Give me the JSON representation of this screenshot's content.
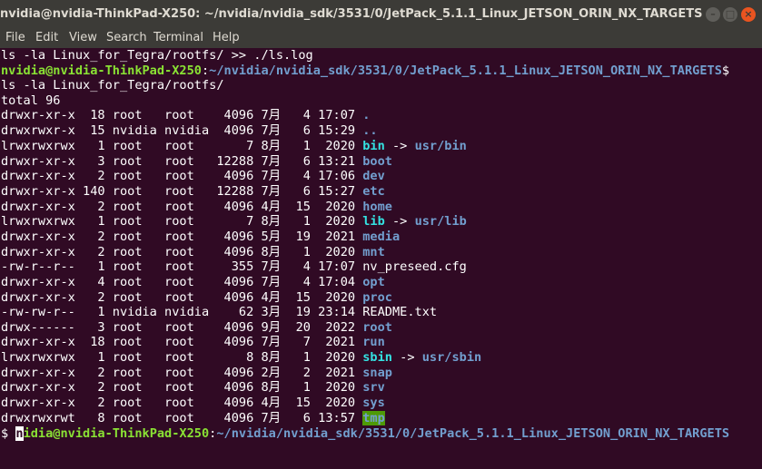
{
  "window": {
    "title": "nvidia@nvidia-ThinkPad-X250: ~/nvidia/nvidia_sdk/3531/0/JetPack_5.1.1_Linux_JETSON_ORIN_NX_TARGETS",
    "minimize_label": "–",
    "maximize_label": "□",
    "close_label": "×"
  },
  "menu": [
    "File",
    "Edit",
    "View",
    "Search",
    "Terminal",
    "Help"
  ],
  "terminal": {
    "cmd1": "ls -la Linux_for_Tegra/rootfs/ >> ./ls.log",
    "prompt_user": "nvidia@nvidia-ThinkPad-X250",
    "prompt_sep": ":",
    "prompt_path": "~/nvidia/nvidia_sdk/3531/0/JetPack_5.1.1_Linux_JETSON_ORIN_NX_TARGETS",
    "prompt_end": "$",
    "cmd2": "ls -la Linux_for_Tegra/rootfs/",
    "total": "total 96",
    "entries": [
      {
        "meta": "drwxr-xr-x  18 root   root    4096 7月   4 17:07 ",
        "name": ".",
        "kind": "dir"
      },
      {
        "meta": "drwxrwxr-x  15 nvidia nvidia  4096 7月   6 15:29 ",
        "name": "..",
        "kind": "dir"
      },
      {
        "meta": "lrwxrwxrwx   1 root   root       7 8月   1  2020 ",
        "name": "bin",
        "kind": "link",
        "target": "usr/bin"
      },
      {
        "meta": "drwxr-xr-x   3 root   root   12288 7月   6 13:21 ",
        "name": "boot",
        "kind": "dir"
      },
      {
        "meta": "drwxr-xr-x   2 root   root    4096 7月   4 17:06 ",
        "name": "dev",
        "kind": "dir"
      },
      {
        "meta": "drwxr-xr-x 140 root   root   12288 7月   6 15:27 ",
        "name": "etc",
        "kind": "dir"
      },
      {
        "meta": "drwxr-xr-x   2 root   root    4096 4月  15  2020 ",
        "name": "home",
        "kind": "dir"
      },
      {
        "meta": "lrwxrwxrwx   1 root   root       7 8月   1  2020 ",
        "name": "lib",
        "kind": "link",
        "target": "usr/lib"
      },
      {
        "meta": "drwxr-xr-x   2 root   root    4096 5月  19  2021 ",
        "name": "media",
        "kind": "dir"
      },
      {
        "meta": "drwxr-xr-x   2 root   root    4096 8月   1  2020 ",
        "name": "mnt",
        "kind": "dir"
      },
      {
        "meta": "-rw-r--r--   1 root   root     355 7月   4 17:07 ",
        "name": "nv_preseed.cfg",
        "kind": "file"
      },
      {
        "meta": "drwxr-xr-x   4 root   root    4096 7月   4 17:04 ",
        "name": "opt",
        "kind": "dir"
      },
      {
        "meta": "drwxr-xr-x   2 root   root    4096 4月  15  2020 ",
        "name": "proc",
        "kind": "dir"
      },
      {
        "meta": "-rw-rw-r--   1 nvidia nvidia    62 3月  19 23:14 ",
        "name": "README.txt",
        "kind": "file"
      },
      {
        "meta": "drwx------   3 root   root    4096 9月  20  2022 ",
        "name": "root",
        "kind": "dir"
      },
      {
        "meta": "drwxr-xr-x  18 root   root    4096 7月   7  2021 ",
        "name": "run",
        "kind": "dir"
      },
      {
        "meta": "lrwxrwxrwx   1 root   root       8 8月   1  2020 ",
        "name": "sbin",
        "kind": "link",
        "target": "usr/sbin"
      },
      {
        "meta": "drwxr-xr-x   2 root   root    4096 2月   2  2021 ",
        "name": "snap",
        "kind": "dir"
      },
      {
        "meta": "drwxr-xr-x   2 root   root    4096 8月   1  2020 ",
        "name": "srv",
        "kind": "dir"
      },
      {
        "meta": "drwxr-xr-x   2 root   root    4096 4月  15  2020 ",
        "name": "sys",
        "kind": "dir"
      },
      {
        "meta": "drwxrwxrwt   8 root   root    4096 7月   6 13:57 ",
        "name": "tmp",
        "kind": "sticky"
      }
    ],
    "arrow": " -> ",
    "last_prompt_prefix": "$ ",
    "last_prompt_cursor_char": "n",
    "last_prompt_user_rest": "idia@nvidia-ThinkPad-X250"
  }
}
